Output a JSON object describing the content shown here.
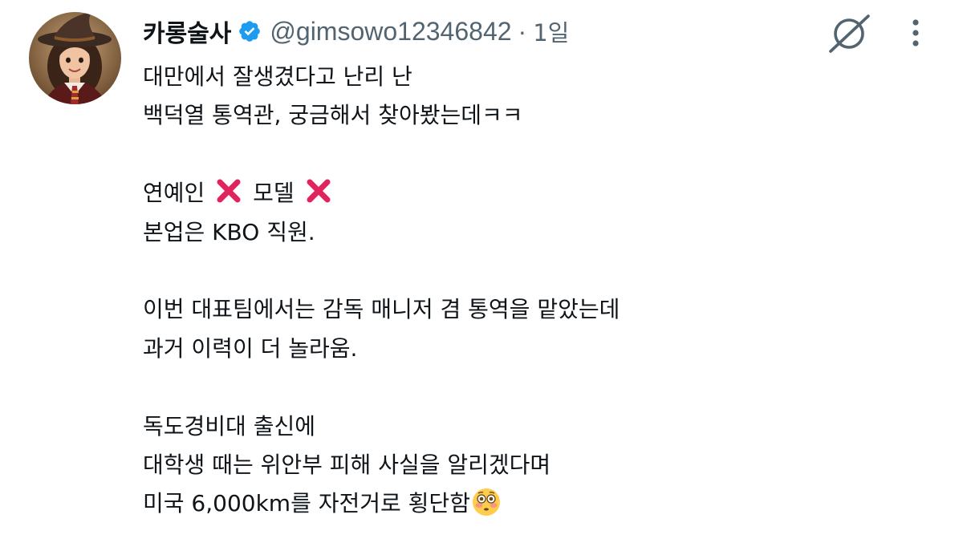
{
  "author": {
    "display_name": "카롱술사",
    "handle": "@gimsowo12346842",
    "separator": "·",
    "timestamp": "1일",
    "verified": true,
    "verified_color": "#1d9bf0"
  },
  "icons": {
    "grok": "grok-icon",
    "more": "more-options-icon",
    "verified": "verified-badge-icon",
    "cross_mark": "cross-mark-emoji",
    "flushed_face": "flushed-face-emoji"
  },
  "tweet": {
    "line1": "대만에서 잘생겼다고 난리 난",
    "line2": "백덕열 통역관, 궁금해서 찾아봤는데ㅋㅋ",
    "line3a": "연예인",
    "line3b": "모델",
    "line4": "본업은 KBO 직원.",
    "line5": "이번 대표팀에서는 감독 매니저 겸 통역을 맡았는데",
    "line6": "과거 이력이 더 놀라움.",
    "line7": "독도경비대 출신에",
    "line8": "대학생 때는 위안부 피해 사실을 알리겠다며",
    "line9": "미국 6,000km를 자전거로 횡단함"
  },
  "colors": {
    "text": "#0f1419",
    "secondary_text": "#536471",
    "cross_mark": "#e0245e"
  }
}
